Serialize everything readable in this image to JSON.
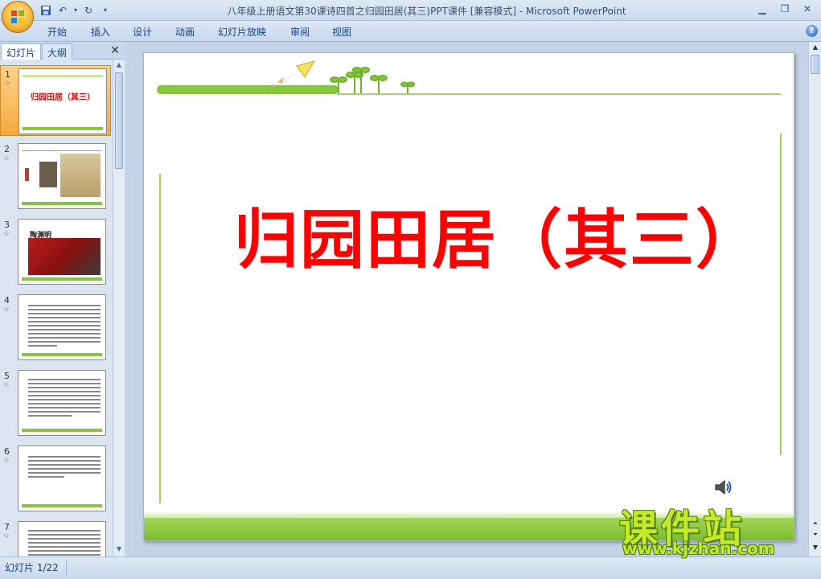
{
  "window": {
    "title_doc": "八年级上册语文第30课诗四首之归园田居(其三)PPT课件 [兼容模式]",
    "title_sep": " - ",
    "title_app": "Microsoft PowerPoint"
  },
  "ribbon": {
    "tabs": [
      "开始",
      "插入",
      "设计",
      "动画",
      "幻灯片放映",
      "审阅",
      "视图"
    ]
  },
  "panel": {
    "tab_slides": "幻灯片",
    "tab_outline": "大纲"
  },
  "thumbnails": [
    {
      "num": "1",
      "title": "归园田居（其三）"
    },
    {
      "num": "2"
    },
    {
      "num": "3",
      "title": "陶渊明"
    },
    {
      "num": "4"
    },
    {
      "num": "5"
    },
    {
      "num": "6"
    },
    {
      "num": "7"
    }
  ],
  "slide": {
    "title": "归园田居（其三）"
  },
  "watermark": {
    "brand": "课件站",
    "url": "www.kjzhan.com"
  },
  "status": {
    "slide_counter": "幻灯片 1/22"
  },
  "colors": {
    "slide_title": "#ff0000",
    "accent_green": "#86c540",
    "selected_thumb": "#f6a941"
  }
}
